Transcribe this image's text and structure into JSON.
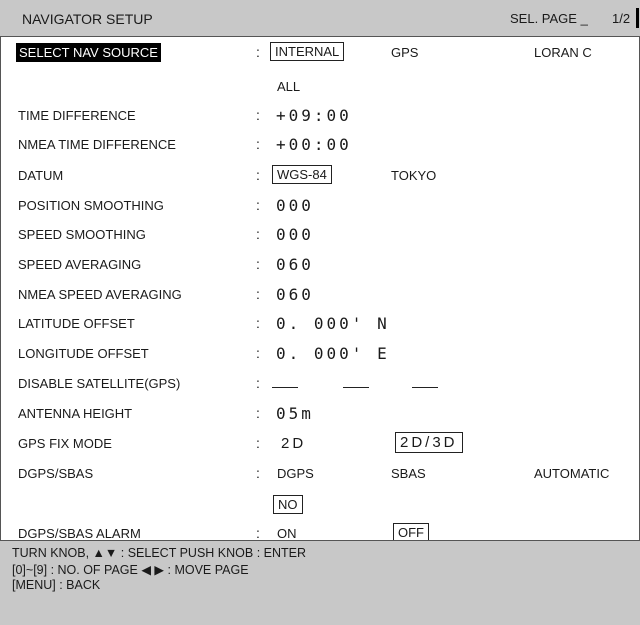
{
  "header": {
    "title": "NAVIGATOR SETUP",
    "page_label": "SEL. PAGE _",
    "page_num": "1/2"
  },
  "rows": [
    {
      "label": "SELECT NAV SOURCE",
      "opts": [
        "INTERNAL",
        "GPS",
        "LORAN C"
      ]
    },
    {
      "opts": [
        "ALL"
      ]
    },
    {
      "label": "TIME DIFFERENCE",
      "value": "+09:00"
    },
    {
      "label": "NMEA TIME DIFFERENCE",
      "value": "+00:00"
    },
    {
      "label": "DATUM",
      "opts": [
        "WGS-84",
        "TOKYO"
      ]
    },
    {
      "label": "POSITION SMOOTHING",
      "value": "000"
    },
    {
      "label": "SPEED SMOOTHING",
      "value": "000"
    },
    {
      "label": "SPEED AVERAGING",
      "value": "060"
    },
    {
      "label": "NMEA SPEED AVERAGING",
      "value": "060"
    },
    {
      "label": "LATITUDE OFFSET",
      "value": "0. 000' N"
    },
    {
      "label": "LONGITUDE OFFSET",
      "value": "0. 000' E"
    },
    {
      "label": "DISABLE SATELLITE(GPS)"
    },
    {
      "label": "ANTENNA HEIGHT",
      "value": "05m"
    },
    {
      "label": "GPS FIX MODE",
      "opts": [
        "2D",
        "2D/3D"
      ]
    },
    {
      "label": "DGPS/SBAS",
      "opts": [
        "DGPS",
        "SBAS",
        "AUTOMATIC"
      ]
    },
    {
      "opts": [
        "NO"
      ]
    },
    {
      "label": "DGPS/SBAS ALARM",
      "opts": [
        "ON",
        "OFF"
      ]
    }
  ],
  "colon": ":",
  "footer": {
    "line1": "TURN KNOB, ▲▼ : SELECT    PUSH KNOB : ENTER",
    "line2": "[0]~[9] : NO. OF PAGE   ◀ ▶ : MOVE PAGE",
    "line3": "[MENU] : BACK"
  }
}
